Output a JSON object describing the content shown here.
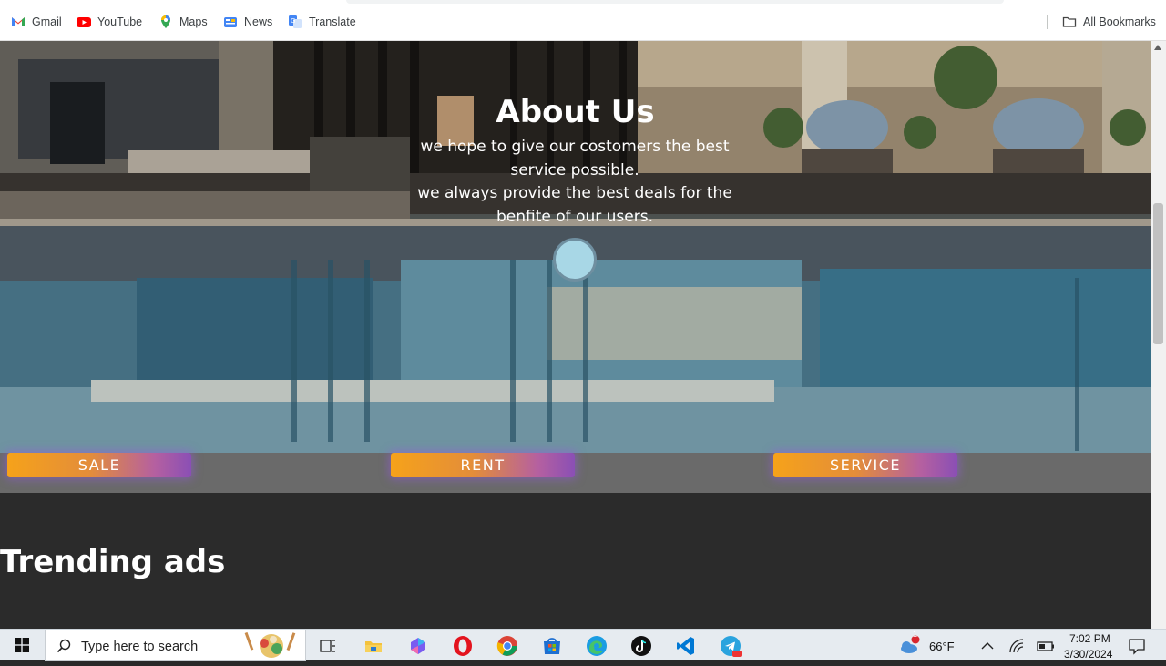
{
  "bookmarks": [
    {
      "label": "Gmail",
      "icon": "gmail-icon"
    },
    {
      "label": "YouTube",
      "icon": "youtube-icon"
    },
    {
      "label": "Maps",
      "icon": "maps-icon"
    },
    {
      "label": "News",
      "icon": "news-icon"
    },
    {
      "label": "Translate",
      "icon": "translate-icon"
    }
  ],
  "all_bookmarks": "All Bookmarks",
  "hero": {
    "title": "About Us",
    "line1": "we hope to give our costomers the best service possible.",
    "line2": "we always provide the best deals for the benfite of our users."
  },
  "buttons": {
    "sale": "SALE",
    "rent": "RENT",
    "service": "SERVICE"
  },
  "section_title": "Trending ads",
  "taskbar": {
    "search_placeholder": "Type here to search",
    "weather": "66°F",
    "weather_badge": "1",
    "time": "7:02 PM",
    "date": "3/30/2024"
  },
  "colors": {
    "pill_start": "#f6a21a",
    "pill_end": "#8a4fb5",
    "strip": "#6a6a6a",
    "dark_bg": "#2b2b2b"
  }
}
